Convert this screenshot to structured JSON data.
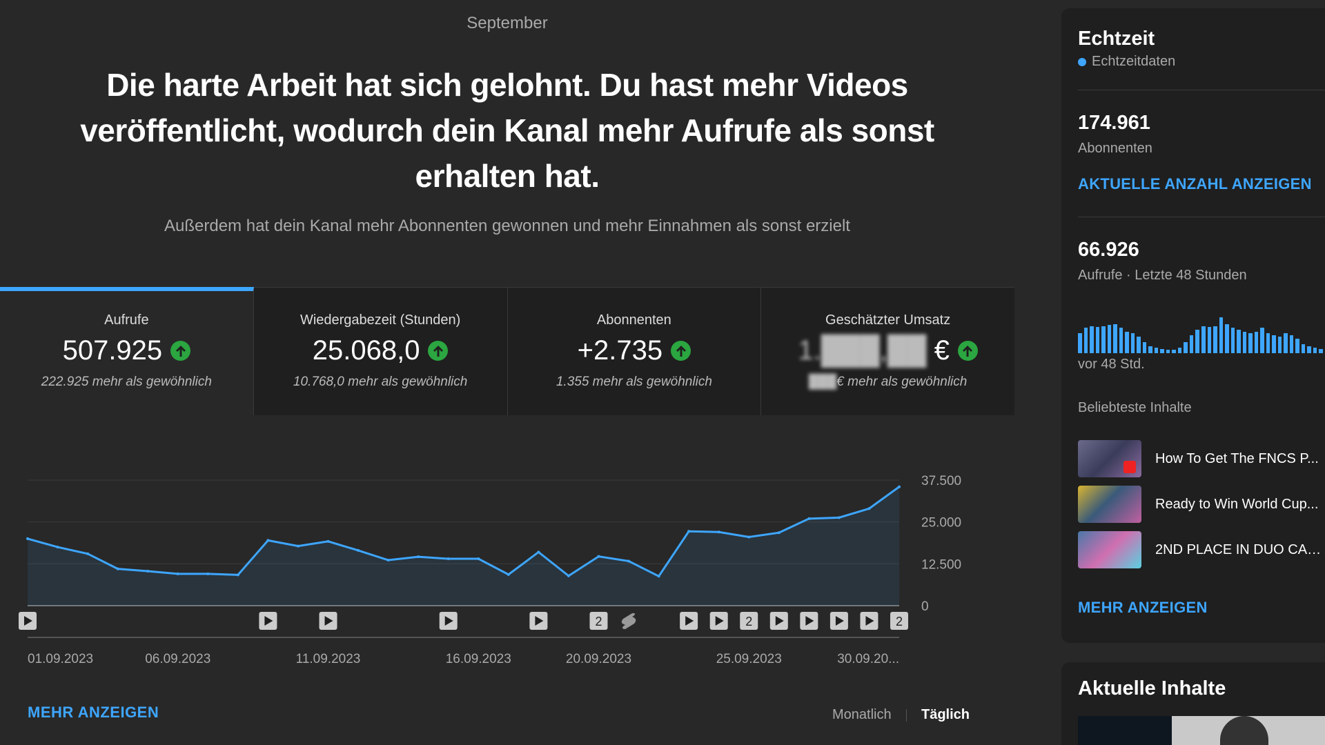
{
  "header": {
    "month": "September",
    "headline": "Die harte Arbeit hat sich gelohnt. Du hast mehr Videos veröffentlicht, wodurch dein Kanal mehr Aufrufe als sonst erhalten hat.",
    "subline": "Außerdem hat dein Kanal mehr Abonnenten gewonnen und mehr Einnahmen als sonst erzielt"
  },
  "cards": [
    {
      "label": "Aufrufe",
      "value": "507.925",
      "sub": "222.925 mehr als gewöhnlich",
      "active": true
    },
    {
      "label": "Wiedergabezeit (Stunden)",
      "value": "25.068,0",
      "sub": "10.768,0 mehr als gewöhnlich",
      "active": false
    },
    {
      "label": "Abonnenten",
      "value": "+2.735",
      "sub": "1.355 mehr als gewöhnlich",
      "active": false
    },
    {
      "label": "Geschätzter Umsatz",
      "value_hidden": "1.███,██",
      "currency": "€",
      "sub_hidden": "███",
      "sub": "€ mehr als gewöhnlich",
      "active": false
    }
  ],
  "chart_data": {
    "type": "area",
    "x": [
      "01.09.2023",
      "02.09.2023",
      "03.09.2023",
      "04.09.2023",
      "05.09.2023",
      "06.09.2023",
      "07.09.2023",
      "08.09.2023",
      "09.09.2023",
      "10.09.2023",
      "11.09.2023",
      "12.09.2023",
      "13.09.2023",
      "14.09.2023",
      "15.09.2023",
      "16.09.2023",
      "17.09.2023",
      "18.09.2023",
      "19.09.2023",
      "20.09.2023",
      "21.09.2023",
      "22.09.2023",
      "23.09.2023",
      "24.09.2023",
      "25.09.2023",
      "26.09.2023",
      "27.09.2023",
      "28.09.2023",
      "29.09.2023",
      "30.09.2023"
    ],
    "values": [
      20000,
      17500,
      15500,
      11000,
      10300,
      9500,
      9500,
      9200,
      19500,
      17800,
      19200,
      16500,
      13600,
      14600,
      14000,
      14000,
      9300,
      16000,
      8900,
      14700,
      13300,
      8800,
      22200,
      22000,
      20500,
      21800,
      26000,
      26300,
      29000,
      35500
    ],
    "tick_labels": [
      "01.09.2023",
      "06.09.2023",
      "11.09.2023",
      "16.09.2023",
      "20.09.2023",
      "25.09.2023",
      "30.09.20..."
    ],
    "tick_indices": [
      0,
      5,
      10,
      15,
      19,
      24,
      29
    ],
    "y_ticks": [
      "0",
      "12.500",
      "25.000",
      "37.500"
    ],
    "y_tick_values": [
      0,
      12500,
      25000,
      37500
    ],
    "ylim": [
      0,
      37500
    ],
    "color": "#3ea6ff",
    "grid": true,
    "markers": [
      {
        "day_index": 0,
        "type": "play"
      },
      {
        "day_index": 8,
        "type": "play"
      },
      {
        "day_index": 10,
        "type": "play"
      },
      {
        "day_index": 14,
        "type": "play"
      },
      {
        "day_index": 17,
        "type": "play"
      },
      {
        "day_index": 19,
        "type": "count",
        "label": "2"
      },
      {
        "day_index": 20,
        "type": "shorts"
      },
      {
        "day_index": 22,
        "type": "play"
      },
      {
        "day_index": 23,
        "type": "play"
      },
      {
        "day_index": 24,
        "type": "count",
        "label": "2"
      },
      {
        "day_index": 25,
        "type": "play"
      },
      {
        "day_index": 26,
        "type": "play"
      },
      {
        "day_index": 27,
        "type": "play"
      },
      {
        "day_index": 28,
        "type": "play"
      },
      {
        "day_index": 29,
        "type": "count",
        "label": "2"
      }
    ]
  },
  "footer": {
    "more_label": "MEHR ANZEIGEN",
    "toggle_monthly": "Monatlich",
    "toggle_daily": "Täglich"
  },
  "sidebar": {
    "title": "Echtzeit",
    "live_label": "Echtzeitdaten",
    "subscribers_value": "174.961",
    "subscribers_label": "Abonnenten",
    "show_count_link": "AKTUELLE ANZAHL ANZEIGEN",
    "views_value": "66.926",
    "views_label": "Aufrufe · Letzte 48 Stunden",
    "bars_relative": [
      0.55,
      0.7,
      0.75,
      0.72,
      0.75,
      0.78,
      0.8,
      0.7,
      0.6,
      0.55,
      0.45,
      0.3,
      0.2,
      0.15,
      0.12,
      0.1,
      0.1,
      0.15,
      0.3,
      0.5,
      0.65,
      0.75,
      0.72,
      0.75,
      1.0,
      0.8,
      0.7,
      0.65,
      0.6,
      0.55,
      0.6,
      0.7,
      0.55,
      0.5,
      0.45,
      0.55,
      0.5,
      0.4,
      0.25,
      0.2,
      0.15,
      0.12
    ],
    "since_label": "vor 48 Std.",
    "popular_label": "Beliebteste Inhalte",
    "popular": [
      "How To Get The FNCS P...",
      "Ready to Win World Cup...",
      "2ND PLACE IN DUO CAS..."
    ],
    "more_link": "MEHR ANZEIGEN",
    "recent_title": "Aktuelle Inhalte"
  }
}
